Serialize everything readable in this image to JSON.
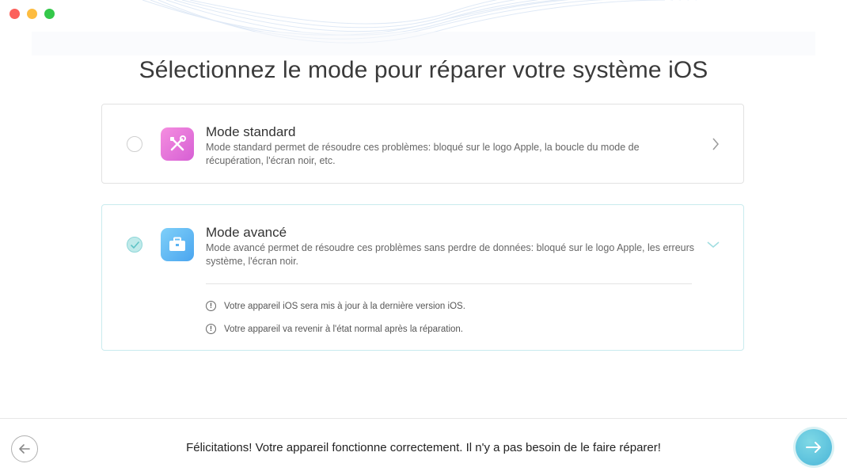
{
  "window": {
    "controls": [
      "close",
      "minimize",
      "maximize"
    ]
  },
  "page": {
    "title": "Sélectionnez le mode pour réparer votre système iOS"
  },
  "modes": [
    {
      "title": "Mode standard",
      "description": "Mode standard permet de résoudre ces problèmes: bloqué sur le logo Apple, la boucle du mode de récupération, l'écran noir, etc.",
      "selected": false,
      "icon": "tools-icon",
      "accent": "#e06bd9"
    },
    {
      "title": "Mode avancé",
      "description": "Mode avancé permet de résoudre ces problèmes sans perdre de données: bloqué sur le logo Apple, les erreurs système, l'écran noir.",
      "selected": true,
      "icon": "briefcase-icon",
      "accent": "#5ab3f2",
      "notes": [
        "Votre appareil iOS sera mis à jour à la dernière version iOS.",
        "Votre appareil va revenir à l'état normal après la réparation."
      ]
    }
  ],
  "footer": {
    "message": "Félicitations! Votre appareil fonctionne correctement. Il n'y a pas besoin de le faire réparer!",
    "back_icon": "arrow-left-icon",
    "next_icon": "arrow-right-icon",
    "next_color": "#4ab5d8"
  }
}
